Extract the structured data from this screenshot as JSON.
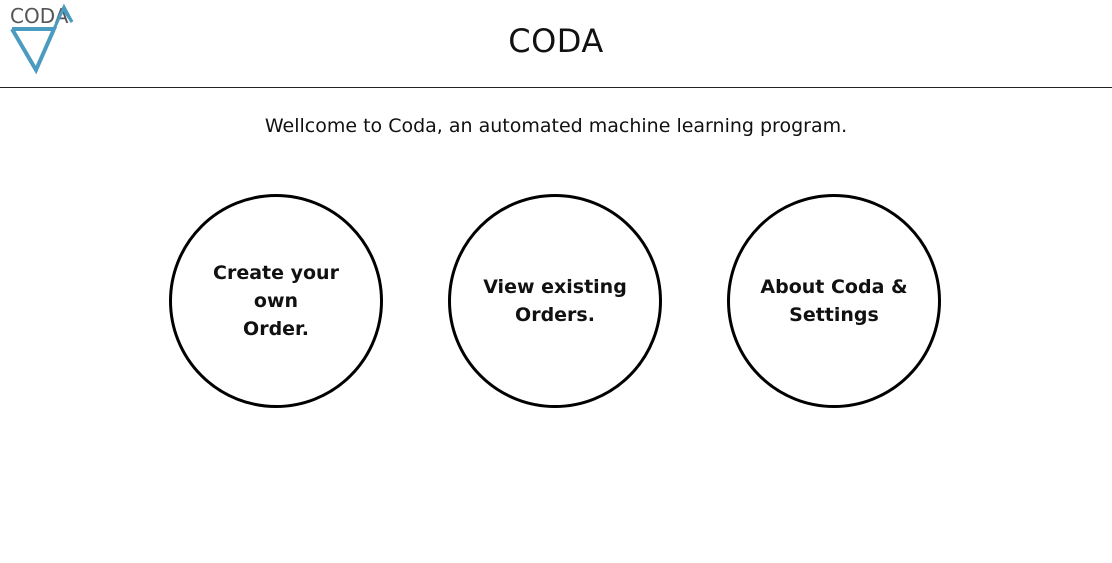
{
  "header": {
    "logo_text": "CODA",
    "title": "CODA",
    "brand_color": "#4a9bbf",
    "logo_text_color": "#555555"
  },
  "main": {
    "welcome_text": "Wellcome to Coda, an automated machine learning program.",
    "buttons": [
      {
        "label": "Create your own\nOrder."
      },
      {
        "label": "View existing\nOrders."
      },
      {
        "label": "About Coda &\nSettings"
      }
    ]
  }
}
